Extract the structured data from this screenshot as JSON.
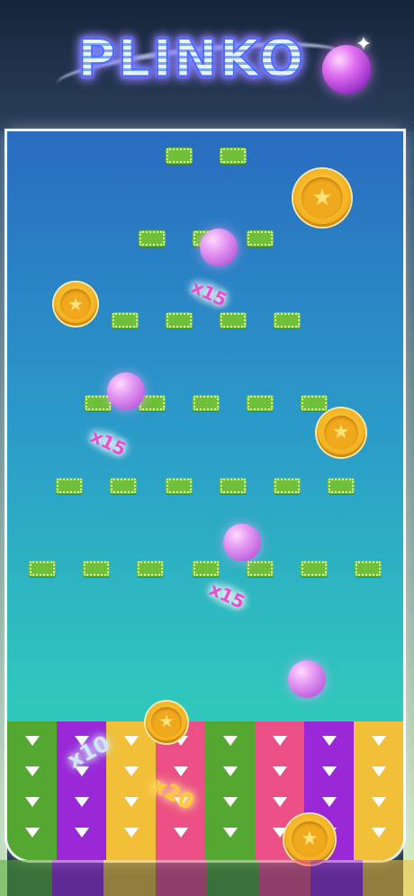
{
  "header": {
    "logo_text": "PLINKO"
  },
  "icons": {
    "coin": "star-coin-icon",
    "ball": "purple-ball",
    "sparkle": "sparkle-icon",
    "arrow": "down-arrow-icon"
  },
  "board": {
    "multiplier_labels": [
      {
        "text": "x15"
      },
      {
        "text": "x15"
      },
      {
        "text": "x15"
      }
    ]
  },
  "lanes": [
    {
      "color": "#54a832"
    },
    {
      "color": "#9a28d6"
    },
    {
      "color": "#f2c038"
    },
    {
      "color": "#ec4f86"
    },
    {
      "color": "#54a832"
    },
    {
      "color": "#ec4f86"
    },
    {
      "color": "#9a28d6"
    },
    {
      "color": "#f2c038"
    }
  ],
  "lane_multipliers": [
    {
      "text": "x10",
      "color": "#9fd0ff"
    },
    {
      "text": "x20",
      "color": "#ffcc33"
    }
  ],
  "colors": {
    "peg": "#6fbf3a",
    "coin": "#f4b423",
    "ball": "#c063e0",
    "multiplier_text": "#e84fcf"
  }
}
